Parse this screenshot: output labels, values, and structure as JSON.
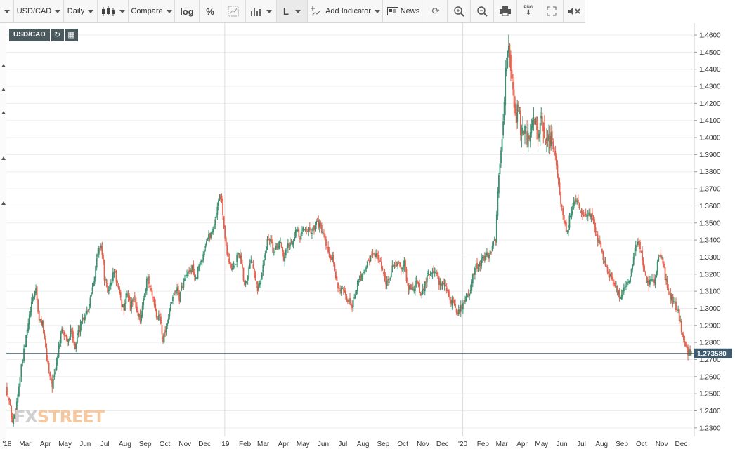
{
  "toolbar": {
    "symbol": "USD/CAD",
    "interval": "Daily",
    "compare": "Compare",
    "log": "log",
    "percent": "%",
    "line_type": "L",
    "add_indicator": "Add Indicator",
    "news": "News",
    "png_label": "PNG"
  },
  "symbol_badge": "USD/CAD",
  "price_tag": "1.273580",
  "logo": {
    "fx": "FX",
    "rest": "STREET"
  },
  "chart_data": {
    "type": "candlestick",
    "symbol": "USD/CAD",
    "interval": "Daily",
    "last_price": 1.27358,
    "ylim": [
      1.225,
      1.467
    ],
    "y_ticks": [
      "1.2300",
      "1.2400",
      "1.2500",
      "1.2600",
      "1.2700",
      "1.2800",
      "1.2900",
      "1.3000",
      "1.3100",
      "1.3200",
      "1.3300",
      "1.3400",
      "1.3500",
      "1.3600",
      "1.3700",
      "1.3800",
      "1.3900",
      "1.4000",
      "1.4100",
      "1.4200",
      "1.4300",
      "1.4400",
      "1.4500",
      "1.4600"
    ],
    "x_ticks": [
      "'18",
      "Mar",
      "Apr",
      "May",
      "Jun",
      "Jul",
      "Aug",
      "Sep",
      "Oct",
      "Nov",
      "Dec",
      "'19",
      "Feb",
      "Mar",
      "Apr",
      "May",
      "Jun",
      "Jul",
      "Aug",
      "Sep",
      "Oct",
      "Nov",
      "Dec",
      "'20",
      "Feb",
      "Mar",
      "Apr",
      "May",
      "Jun",
      "Jul",
      "Aug",
      "Sep",
      "Oct",
      "Nov",
      "Dec"
    ],
    "year_lines": [
      "'19",
      "'20"
    ],
    "up_color": "#3d8f6f",
    "down_color": "#e2604d",
    "grid": true,
    "series_close": [
      [
        "2018-02-01",
        1.254
      ],
      [
        "2018-02-06",
        1.246
      ],
      [
        "2018-02-11",
        1.233
      ],
      [
        "2018-02-16",
        1.24
      ],
      [
        "2018-02-21",
        1.255
      ],
      [
        "2018-02-27",
        1.27
      ],
      [
        "2018-03-04",
        1.283
      ],
      [
        "2018-03-09",
        1.295
      ],
      [
        "2018-03-14",
        1.305
      ],
      [
        "2018-03-19",
        1.312
      ],
      [
        "2018-03-24",
        1.292
      ],
      [
        "2018-03-29",
        1.292
      ],
      [
        "2018-04-03",
        1.276
      ],
      [
        "2018-04-08",
        1.264
      ],
      [
        "2018-04-13",
        1.255
      ],
      [
        "2018-04-18",
        1.262
      ],
      [
        "2018-04-23",
        1.278
      ],
      [
        "2018-04-28",
        1.286
      ],
      [
        "2018-05-03",
        1.284
      ],
      [
        "2018-05-08",
        1.28
      ],
      [
        "2018-05-13",
        1.289
      ],
      [
        "2018-05-18",
        1.276
      ],
      [
        "2018-05-23",
        1.286
      ],
      [
        "2018-05-28",
        1.293
      ],
      [
        "2018-06-02",
        1.296
      ],
      [
        "2018-06-07",
        1.3
      ],
      [
        "2018-06-12",
        1.31
      ],
      [
        "2018-06-17",
        1.32
      ],
      [
        "2018-06-22",
        1.332
      ],
      [
        "2018-06-27",
        1.338
      ],
      [
        "2018-07-02",
        1.318
      ],
      [
        "2018-07-07",
        1.31
      ],
      [
        "2018-07-12",
        1.314
      ],
      [
        "2018-07-17",
        1.322
      ],
      [
        "2018-07-22",
        1.314
      ],
      [
        "2018-07-27",
        1.304
      ],
      [
        "2018-08-01",
        1.3
      ],
      [
        "2018-08-06",
        1.31
      ],
      [
        "2018-08-11",
        1.3
      ],
      [
        "2018-08-16",
        1.308
      ],
      [
        "2018-08-21",
        1.298
      ],
      [
        "2018-08-26",
        1.294
      ],
      [
        "2018-08-31",
        1.304
      ],
      [
        "2018-09-05",
        1.318
      ],
      [
        "2018-09-10",
        1.312
      ],
      [
        "2018-09-15",
        1.304
      ],
      [
        "2018-09-20",
        1.294
      ],
      [
        "2018-09-25",
        1.296
      ],
      [
        "2018-09-30",
        1.282
      ],
      [
        "2018-10-05",
        1.29
      ],
      [
        "2018-10-10",
        1.298
      ],
      [
        "2018-10-15",
        1.306
      ],
      [
        "2018-10-20",
        1.312
      ],
      [
        "2018-10-25",
        1.306
      ],
      [
        "2018-10-30",
        1.314
      ],
      [
        "2018-11-04",
        1.318
      ],
      [
        "2018-11-09",
        1.32
      ],
      [
        "2018-11-14",
        1.324
      ],
      [
        "2018-11-19",
        1.316
      ],
      [
        "2018-11-24",
        1.324
      ],
      [
        "2018-11-29",
        1.33
      ],
      [
        "2018-12-04",
        1.338
      ],
      [
        "2018-12-09",
        1.342
      ],
      [
        "2018-12-14",
        1.345
      ],
      [
        "2018-12-19",
        1.352
      ],
      [
        "2018-12-24",
        1.364
      ],
      [
        "2018-12-29",
        1.364
      ],
      [
        "2019-01-03",
        1.34
      ],
      [
        "2019-01-08",
        1.33
      ],
      [
        "2019-01-13",
        1.322
      ],
      [
        "2019-01-18",
        1.325
      ],
      [
        "2019-01-23",
        1.333
      ],
      [
        "2019-01-28",
        1.328
      ],
      [
        "2019-02-02",
        1.314
      ],
      [
        "2019-02-07",
        1.32
      ],
      [
        "2019-02-12",
        1.33
      ],
      [
        "2019-02-17",
        1.322
      ],
      [
        "2019-02-22",
        1.312
      ],
      [
        "2019-02-27",
        1.316
      ],
      [
        "2019-03-04",
        1.33
      ],
      [
        "2019-03-09",
        1.34
      ],
      [
        "2019-03-14",
        1.34
      ],
      [
        "2019-03-19",
        1.332
      ],
      [
        "2019-03-24",
        1.336
      ],
      [
        "2019-03-29",
        1.34
      ],
      [
        "2019-04-03",
        1.33
      ],
      [
        "2019-04-08",
        1.336
      ],
      [
        "2019-04-13",
        1.338
      ],
      [
        "2019-04-18",
        1.342
      ],
      [
        "2019-04-23",
        1.346
      ],
      [
        "2019-04-28",
        1.34
      ],
      [
        "2019-05-03",
        1.346
      ],
      [
        "2019-05-08",
        1.348
      ],
      [
        "2019-05-13",
        1.344
      ],
      [
        "2019-05-18",
        1.346
      ],
      [
        "2019-05-23",
        1.352
      ],
      [
        "2019-05-28",
        1.348
      ],
      [
        "2019-06-02",
        1.344
      ],
      [
        "2019-06-07",
        1.336
      ],
      [
        "2019-06-12",
        1.33
      ],
      [
        "2019-06-17",
        1.328
      ],
      [
        "2019-06-22",
        1.318
      ],
      [
        "2019-06-27",
        1.312
      ],
      [
        "2019-07-02",
        1.31
      ],
      [
        "2019-07-07",
        1.306
      ],
      [
        "2019-07-12",
        1.304
      ],
      [
        "2019-07-17",
        1.302
      ],
      [
        "2019-07-22",
        1.31
      ],
      [
        "2019-07-27",
        1.316
      ],
      [
        "2019-08-01",
        1.32
      ],
      [
        "2019-08-06",
        1.324
      ],
      [
        "2019-08-11",
        1.328
      ],
      [
        "2019-08-16",
        1.33
      ],
      [
        "2019-08-21",
        1.332
      ],
      [
        "2019-08-26",
        1.328
      ],
      [
        "2019-08-31",
        1.324
      ],
      [
        "2019-09-05",
        1.316
      ],
      [
        "2019-09-10",
        1.314
      ],
      [
        "2019-09-15",
        1.322
      ],
      [
        "2019-09-20",
        1.326
      ],
      [
        "2019-09-25",
        1.326
      ],
      [
        "2019-09-30",
        1.324
      ],
      [
        "2019-10-05",
        1.326
      ],
      [
        "2019-10-10",
        1.314
      ],
      [
        "2019-10-15",
        1.31
      ],
      [
        "2019-10-20",
        1.312
      ],
      [
        "2019-10-25",
        1.316
      ],
      [
        "2019-10-30",
        1.306
      ],
      [
        "2019-11-04",
        1.312
      ],
      [
        "2019-11-09",
        1.318
      ],
      [
        "2019-11-14",
        1.32
      ],
      [
        "2019-11-19",
        1.322
      ],
      [
        "2019-11-24",
        1.32
      ],
      [
        "2019-11-29",
        1.314
      ],
      [
        "2019-12-04",
        1.316
      ],
      [
        "2019-12-09",
        1.31
      ],
      [
        "2019-12-14",
        1.306
      ],
      [
        "2019-12-19",
        1.302
      ],
      [
        "2019-12-24",
        1.298
      ],
      [
        "2019-12-29",
        1.298
      ],
      [
        "2020-01-03",
        1.304
      ],
      [
        "2020-01-08",
        1.306
      ],
      [
        "2020-01-13",
        1.31
      ],
      [
        "2020-01-18",
        1.318
      ],
      [
        "2020-01-23",
        1.324
      ],
      [
        "2020-01-28",
        1.326
      ],
      [
        "2020-02-02",
        1.328
      ],
      [
        "2020-02-07",
        1.33
      ],
      [
        "2020-02-12",
        1.332
      ],
      [
        "2020-02-17",
        1.336
      ],
      [
        "2020-02-22",
        1.34
      ],
      [
        "2020-02-27",
        1.38
      ],
      [
        "2020-03-03",
        1.398
      ],
      [
        "2020-03-08",
        1.44
      ],
      [
        "2020-03-13",
        1.452
      ],
      [
        "2020-03-18",
        1.432
      ],
      [
        "2020-03-23",
        1.41
      ],
      [
        "2020-03-28",
        1.42
      ],
      [
        "2020-04-02",
        1.4
      ],
      [
        "2020-04-07",
        1.402
      ],
      [
        "2020-04-12",
        1.398
      ],
      [
        "2020-04-17",
        1.404
      ],
      [
        "2020-04-22",
        1.41
      ],
      [
        "2020-04-27",
        1.402
      ],
      [
        "2020-05-02",
        1.408
      ],
      [
        "2020-05-07",
        1.398
      ],
      [
        "2020-05-12",
        1.394
      ],
      [
        "2020-05-17",
        1.4
      ],
      [
        "2020-05-22",
        1.392
      ],
      [
        "2020-05-27",
        1.378
      ],
      [
        "2020-06-01",
        1.362
      ],
      [
        "2020-06-06",
        1.352
      ],
      [
        "2020-06-11",
        1.344
      ],
      [
        "2020-06-16",
        1.356
      ],
      [
        "2020-06-21",
        1.362
      ],
      [
        "2020-06-26",
        1.362
      ],
      [
        "2020-07-01",
        1.356
      ],
      [
        "2020-07-06",
        1.352
      ],
      [
        "2020-07-11",
        1.356
      ],
      [
        "2020-07-16",
        1.354
      ],
      [
        "2020-07-21",
        1.352
      ],
      [
        "2020-07-26",
        1.342
      ],
      [
        "2020-07-31",
        1.338
      ],
      [
        "2020-08-05",
        1.33
      ],
      [
        "2020-08-10",
        1.324
      ],
      [
        "2020-08-15",
        1.32
      ],
      [
        "2020-08-20",
        1.316
      ],
      [
        "2020-08-25",
        1.312
      ],
      [
        "2020-08-30",
        1.306
      ],
      [
        "2020-09-04",
        1.31
      ],
      [
        "2020-09-09",
        1.314
      ],
      [
        "2020-09-14",
        1.318
      ],
      [
        "2020-09-19",
        1.324
      ],
      [
        "2020-09-24",
        1.336
      ],
      [
        "2020-09-29",
        1.34
      ],
      [
        "2020-10-04",
        1.328
      ],
      [
        "2020-10-09",
        1.318
      ],
      [
        "2020-10-14",
        1.314
      ],
      [
        "2020-10-19",
        1.318
      ],
      [
        "2020-10-24",
        1.316
      ],
      [
        "2020-10-29",
        1.332
      ],
      [
        "2020-11-03",
        1.33
      ],
      [
        "2020-11-08",
        1.318
      ],
      [
        "2020-11-13",
        1.31
      ],
      [
        "2020-11-18",
        1.306
      ],
      [
        "2020-11-23",
        1.302
      ],
      [
        "2020-11-28",
        1.298
      ],
      [
        "2020-12-03",
        1.288
      ],
      [
        "2020-12-08",
        1.28
      ],
      [
        "2020-12-13",
        1.274
      ],
      [
        "2020-12-18",
        1.2736
      ]
    ]
  }
}
